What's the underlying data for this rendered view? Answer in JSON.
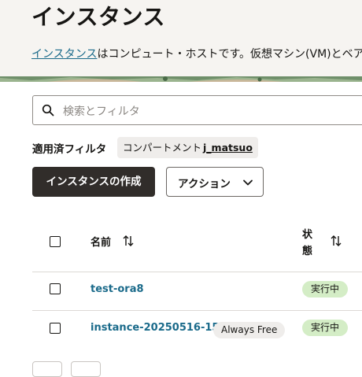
{
  "page": {
    "title": "インスタンス",
    "description_link": "インスタンス",
    "description_text": "はコンピュート・ホストです。仮想マシン(VM)とベア"
  },
  "search": {
    "placeholder": "検索とフィルタ"
  },
  "filters": {
    "label": "適用済フィルタ",
    "chip_prefix": "コンパートメント",
    "chip_value": "j_matsuo"
  },
  "toolbar": {
    "create_label": "インスタンスの作成",
    "action_label": "アクション"
  },
  "table": {
    "columns": {
      "name": "名前",
      "status": "状態"
    },
    "rows": [
      {
        "name": "test-ora8",
        "badge": "",
        "status": "実行中"
      },
      {
        "name": "instance-20250516-1509",
        "badge": "Always Free",
        "status": "実行中"
      }
    ]
  },
  "colors": {
    "primary_button": "#312d2a",
    "link": "#1a6a8a",
    "running_badge": "#d4edc6",
    "header_bg": "#f6f4f1"
  },
  "icons": [
    "search-icon",
    "chevron-down-icon",
    "sort-icon"
  ]
}
